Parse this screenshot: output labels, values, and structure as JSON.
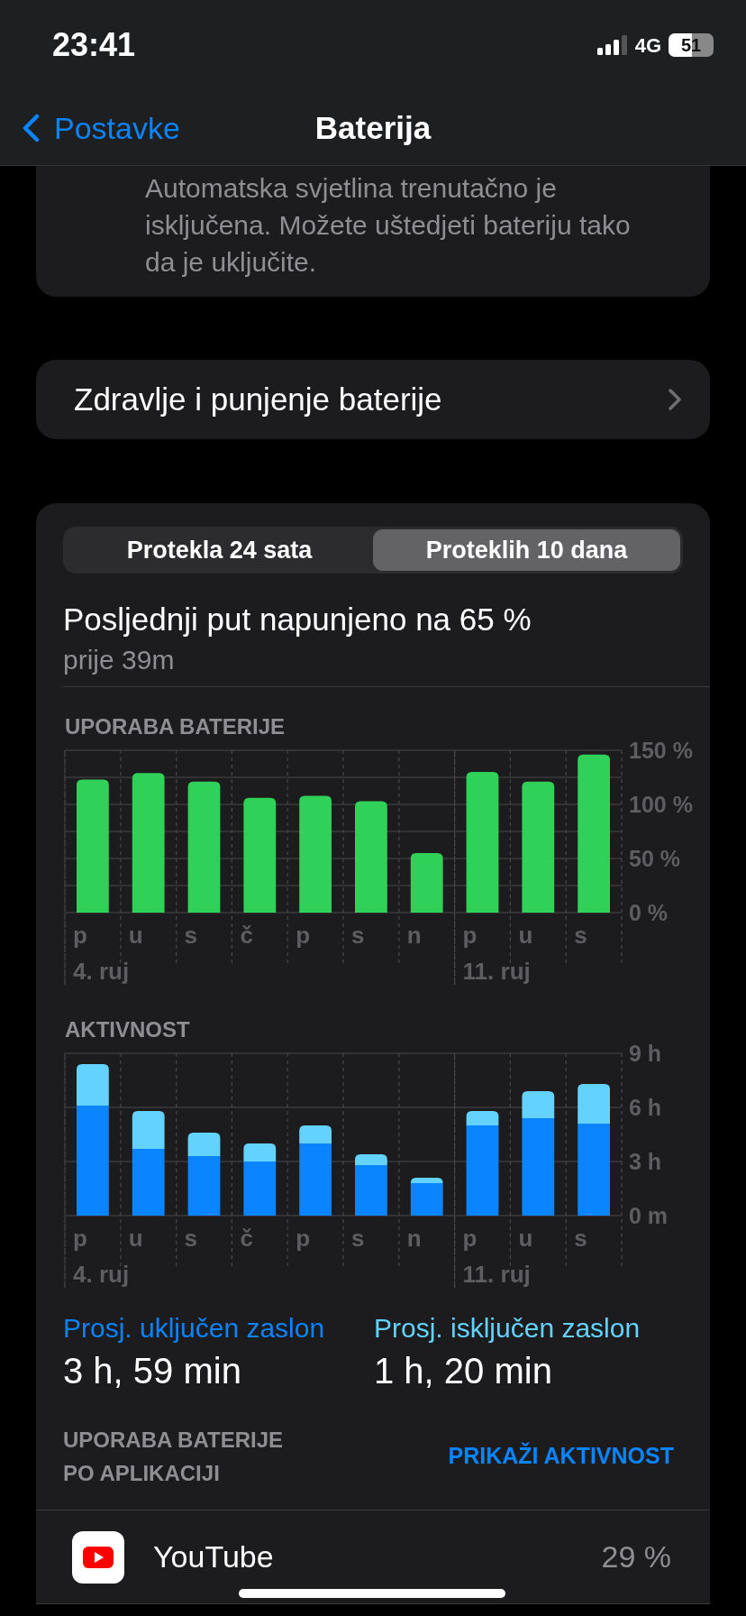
{
  "status_bar": {
    "time": "23:41",
    "network": "4G",
    "battery": "51"
  },
  "nav": {
    "back": "Postavke",
    "title": "Baterija"
  },
  "brightness_note": "Automatska svjetlina trenutačno je isključena. Možete uštedjeti bateriju tako da je uključite.",
  "health_row": {
    "label": "Zdravlje i punjenje baterije"
  },
  "tabs": [
    {
      "label": "Protekla 24 sata",
      "selected": false
    },
    {
      "label": "Proteklih 10 dana",
      "selected": true
    }
  ],
  "last_charge": {
    "title": "Posljednji put napunjeno na 65 %",
    "subtitle": "prije 39m"
  },
  "usage_chart": {
    "title": "UPORABA BATERIJE",
    "chart_data": {
      "type": "bar",
      "categories": [
        "p",
        "u",
        "s",
        "č",
        "p",
        "s",
        "n",
        "p",
        "u",
        "s"
      ],
      "series": [
        {
          "color": "#30d158",
          "values": [
            123,
            129,
            121,
            106,
            108,
            103,
            55,
            130,
            121,
            146
          ]
        }
      ],
      "ylim": [
        0,
        150
      ],
      "yticks": [
        {
          "value": 150,
          "label": "150 %"
        },
        {
          "value": 100,
          "label": "100 %"
        },
        {
          "value": 50,
          "label": "50 %"
        },
        {
          "value": 0,
          "label": "0 %"
        }
      ],
      "annotations": [
        "4. ruj",
        "11. ruj"
      ]
    }
  },
  "activity_chart": {
    "title": "AKTIVNOST",
    "chart_data": {
      "type": "bar",
      "stacked": true,
      "categories": [
        "p",
        "u",
        "s",
        "č",
        "p",
        "s",
        "n",
        "p",
        "u",
        "s"
      ],
      "series": [
        {
          "color": "#0a84ff",
          "values": [
            6.1,
            3.7,
            3.3,
            3.0,
            4.0,
            2.8,
            1.8,
            5.0,
            5.4,
            5.1
          ]
        },
        {
          "color": "#64d2ff",
          "values": [
            2.3,
            2.1,
            1.3,
            1.0,
            1.0,
            0.6,
            0.3,
            0.8,
            1.5,
            2.2
          ]
        }
      ],
      "ylim": [
        0,
        9
      ],
      "yticks": [
        {
          "value": 9,
          "label": "9 h"
        },
        {
          "value": 6,
          "label": "6 h"
        },
        {
          "value": 3,
          "label": "3 h"
        },
        {
          "value": 0,
          "label": "0 m"
        }
      ],
      "annotations": [
        "4. ruj",
        "11. ruj"
      ]
    }
  },
  "stats": [
    {
      "label": "Prosj. uključen zaslon",
      "value": "3 h, 59 min",
      "color": "#0a84ff"
    },
    {
      "label": "Prosj. isključen zaslon",
      "value": "1 h, 20 min",
      "color": "#64d2ff"
    }
  ],
  "app_usage": {
    "title": "UPORABA BATERIJE PO APLIKACIJI",
    "action": "PRIKAŽI AKTIVNOST",
    "apps": [
      {
        "name": "YouTube",
        "percent": "29 %"
      }
    ]
  }
}
